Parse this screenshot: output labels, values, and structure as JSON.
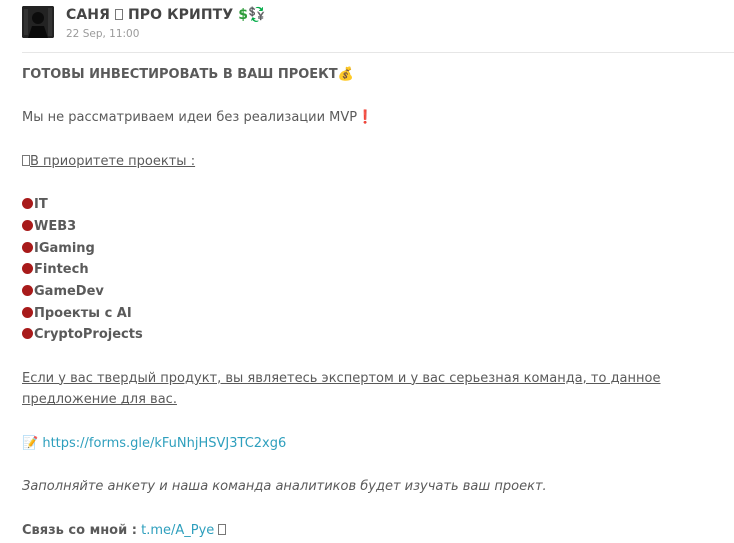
{
  "colors": {
    "link": "#2e9fbd",
    "bullet": "#a81a1a",
    "money": "#3a9a3a",
    "text": "#5a5a5a",
    "date": "#9a9a9a"
  },
  "post": {
    "channel_name": "САНЯ",
    "channel_name_tail": "ПРО КРИПТУ",
    "channel_emoji": "$💱",
    "date": "22 Sep, 11:00",
    "avatar_icon": "channel-avatar",
    "headline": "ГОТОВЫ ИНВЕСТИРОВАТЬ В ВАШ ПРОЕКТ",
    "headline_emoji": "💰",
    "mvp_text": "Мы не рассматриваем идеи без реализации MVP",
    "mvp_mark": "❗",
    "priority_heading": "В приоритете проекты :",
    "priorities": [
      "IT",
      "WEB3",
      "IGaming",
      "Fintech",
      "GameDev",
      "Проекты с AI",
      "CryptoProjects"
    ],
    "offer_text": "Если у вас твердый продукт, вы являетесь экспертом и у вас серьезная команда, то данное предложение для вас.",
    "form_icon": "📝",
    "form_link": "https://forms.gle/kFuNhjHSVJ3TC2xg6",
    "form_note": "Заполняйте анкету и наша команда аналитиков будет изучать ваш проект.",
    "contact_label": "Связь со мной :",
    "contact_link": "t.me/A_Pye"
  }
}
